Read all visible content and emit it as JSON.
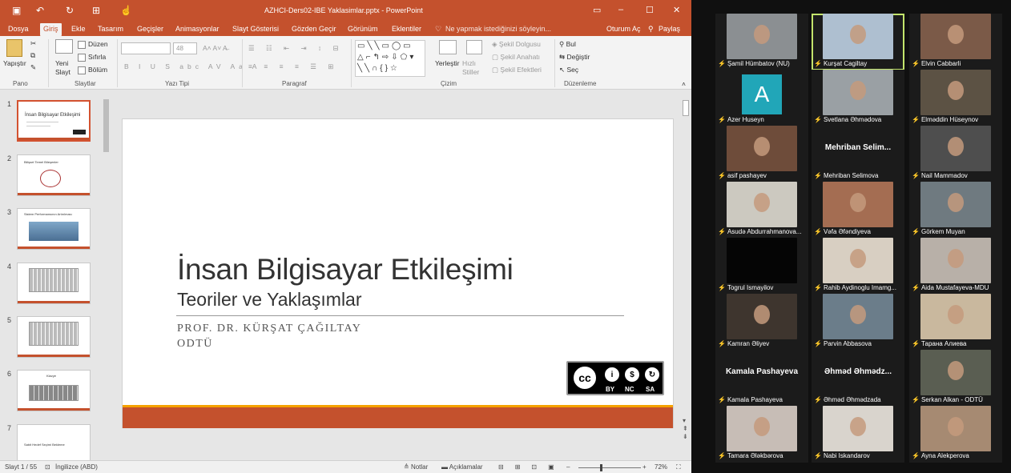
{
  "ppt": {
    "window_title": "AZHCI-Ders02-IBE Yaklasimlar.pptx - PowerPoint",
    "menu": [
      "Dosya",
      "Giriş",
      "Ekle",
      "Tasarım",
      "Geçişler",
      "Animasyonlar",
      "Slayt Gösterisi",
      "Gözden Geçir",
      "Görünüm",
      "Eklentiler"
    ],
    "active_tab": "Giriş",
    "tell_me": "Ne yapmak istediğinizi söyleyin...",
    "signin": "Oturum Aç",
    "share": "Paylaş",
    "ribbon": {
      "paste": "Yapıştır",
      "new_slide": "Yeni Slayt",
      "layout": "Düzen",
      "reset": "Sıfırla",
      "section": "Bölüm",
      "font_size": "48",
      "arrange": "Yerleştir",
      "quick_styles": "Hızlı Stiller",
      "shape_fill": "Şekil Dolgusu",
      "shape_outline": "Şekil Anahatı",
      "shape_effects": "Şekil Efektleri",
      "find": "Bul",
      "replace": "Değiştir",
      "select": "Seç",
      "groups": {
        "clipboard": "Pano",
        "slides": "Slaytlar",
        "font": "Yazı Tipi",
        "paragraph": "Paragraf",
        "drawing": "Çizim",
        "editing": "Düzenleme"
      }
    },
    "thumbnails": [
      {
        "num": "1",
        "title": "İnsan Bilgisayar Etkileşimi"
      },
      {
        "num": "2",
        "title": "Bilişsel Temel Bileşenler"
      },
      {
        "num": "3",
        "title": "Sistem Performansının Artırılması"
      },
      {
        "num": "4",
        "title": ""
      },
      {
        "num": "5",
        "title": ""
      },
      {
        "num": "6",
        "title": "Klavye"
      },
      {
        "num": "7",
        "title": "Sabit Hedef Seçimi Bekleme"
      }
    ],
    "slide": {
      "title": "İnsan Bilgisayar Etkileşimi",
      "subtitle": "Teoriler ve Yaklaşımlar",
      "author": "PROF. DR. KÜRŞAT ÇAĞILTAY",
      "org": "ODTÜ",
      "license": [
        "BY",
        "NC",
        "SA"
      ],
      "license_badge": "cc"
    },
    "status": {
      "slide_counter": "Slayt 1 / 55",
      "language": "İngilizce (ABD)",
      "notes": "Notlar",
      "comments": "Açıklamalar",
      "zoom": "72%"
    },
    "colors": {
      "accent": "#c4512d",
      "stripe": "#f5a200"
    }
  },
  "zoom": {
    "participants": [
      {
        "name": "Şamil Hümbatov (NU)",
        "video": true,
        "bg": "#8b8f92"
      },
      {
        "name": "Kurşat Cagiltay",
        "video": true,
        "bg": "#aebfd0",
        "speaking": true
      },
      {
        "name": "Elvin Cabbarli",
        "video": true,
        "bg": "#7b5a48"
      },
      {
        "name": "Azer Huseyn",
        "video": false,
        "avatar_letter": "A"
      },
      {
        "name": "Svetlana Əhmədova",
        "video": true,
        "bg": "#9aa0a4"
      },
      {
        "name": "Elməddin Hüseynov",
        "video": true,
        "bg": "#5c5244"
      },
      {
        "name": "asif pashayev",
        "video": true,
        "bg": "#6e4c3a"
      },
      {
        "name": "Mehriban Selimova",
        "video": false,
        "big_label": "Mehriban  Selim..."
      },
      {
        "name": "Nail Mammadov",
        "video": true,
        "bg": "#4e4e4e"
      },
      {
        "name": "Asudə Abdurrahmanova...",
        "video": true,
        "bg": "#ccc9c0"
      },
      {
        "name": "Vəfa Əfəndiyeva",
        "video": true,
        "bg": "#a46d52"
      },
      {
        "name": "Görkem Muyan",
        "video": true,
        "bg": "#6f7a80"
      },
      {
        "name": "Togrul Ismayilov",
        "video": true,
        "bg": "#050505"
      },
      {
        "name": "Rahib Aydinoglu Imamg...",
        "video": true,
        "bg": "#d8cfc2"
      },
      {
        "name": "Aida Mustafayeva-MDU",
        "video": true,
        "bg": "#b8b0a8"
      },
      {
        "name": "Kamran Əliyev",
        "video": true,
        "bg": "#3e352e"
      },
      {
        "name": "Parvin Abbasova",
        "video": true,
        "bg": "#6b7d8a"
      },
      {
        "name": "Тарана Алиева",
        "video": true,
        "bg": "#c9b89e"
      },
      {
        "name": "Kamala Pashayeva",
        "video": false,
        "big_label": "Kamala Pashayeva"
      },
      {
        "name": "Əhməd Əhmədzada",
        "video": false,
        "big_label": "Əhməd  Əhmədz..."
      },
      {
        "name": "Serkan Alkan - ODTÜ",
        "video": true,
        "bg": "#5a5e52"
      },
      {
        "name": "Tamara Ələkbərova",
        "video": true,
        "bg": "#c7bdb6"
      },
      {
        "name": "Nabi Iskandarov",
        "video": true,
        "bg": "#d9d4cd"
      },
      {
        "name": "Ayna Alekperova",
        "video": true,
        "bg": "#a68a72"
      }
    ]
  }
}
